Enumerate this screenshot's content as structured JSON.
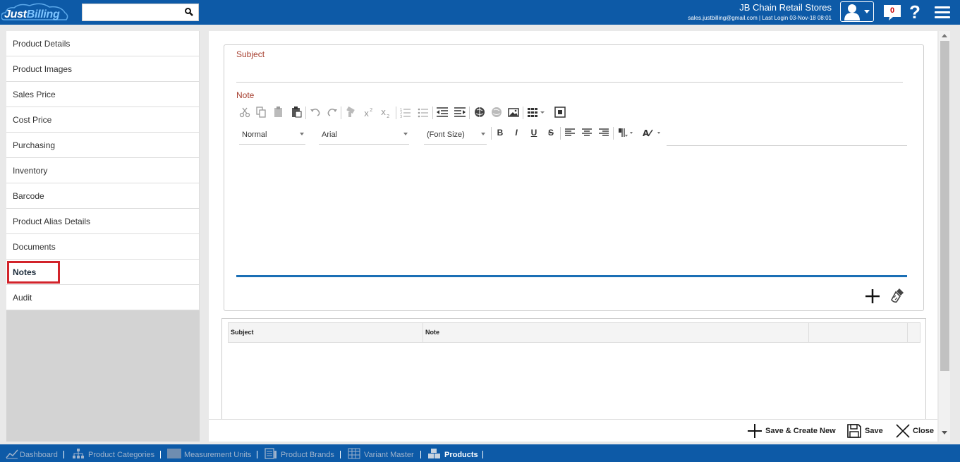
{
  "header": {
    "logo_part1": "Just",
    "logo_part2": "Billing",
    "search_placeholder": "",
    "store_name": "JB Chain Retail Stores",
    "login_info": "sales.justbilling@gmail.com | Last Login 03-Nov-18 08:01",
    "notification_count": "0",
    "help_glyph": "?"
  },
  "sidebar": {
    "items": [
      {
        "label": "Product Details"
      },
      {
        "label": "Product Images"
      },
      {
        "label": "Sales Price"
      },
      {
        "label": "Cost Price"
      },
      {
        "label": "Purchasing"
      },
      {
        "label": "Inventory"
      },
      {
        "label": "Barcode"
      },
      {
        "label": "Product Alias Details"
      },
      {
        "label": "Documents"
      },
      {
        "label": "Notes"
      },
      {
        "label": "Audit"
      }
    ],
    "active_index": 9
  },
  "form": {
    "subject_label": "Subject",
    "note_label": "Note",
    "format_value": "Normal",
    "font_value": "Arial",
    "size_value": "(Font Size)",
    "bold": "B",
    "italic": "I",
    "underline": "U",
    "strike": "S"
  },
  "grid": {
    "columns": [
      "Subject",
      "Note"
    ]
  },
  "actions": {
    "save_create_new": "Save & Create New",
    "save": "Save",
    "close": "Close"
  },
  "footer": {
    "items": [
      {
        "label": "Dashboard"
      },
      {
        "label": "Product Categories"
      },
      {
        "label": "Measurement Units"
      },
      {
        "label": "Product Brands"
      },
      {
        "label": "Variant Master"
      },
      {
        "label": "Products"
      }
    ]
  },
  "colors": {
    "header_bg": "#0d5aa7",
    "label_red": "#a63e2e",
    "active_outline": "#d2232a",
    "editor_accent": "#1b6fb5"
  }
}
